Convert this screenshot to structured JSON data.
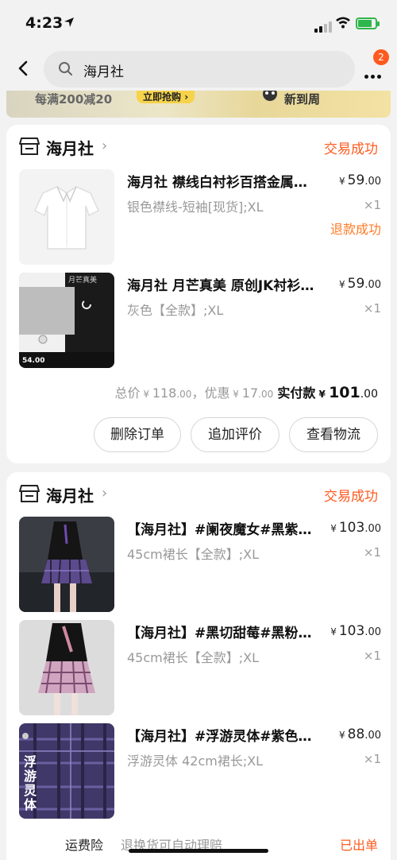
{
  "status_bar": {
    "time": "4:23",
    "location_icon": "location-arrow-icon",
    "battery_color": "#2fb64c"
  },
  "nav": {
    "search_text": "海月社",
    "badge_count": "2"
  },
  "banner": {
    "promo_text": "每满200减20",
    "button_label": "立即抢购",
    "right_text": "新到周"
  },
  "colors": {
    "accent": "#ff5a1f",
    "refund": "#ff7a26"
  },
  "orders": [
    {
      "shop_name": "海月社",
      "status": "交易成功",
      "items": [
        {
          "title": "海月社 襟线白衬衫百搭金属扣短袖衬衫",
          "price_currency": "¥",
          "price_int": "59",
          "price_dec": ".00",
          "variant": "银色襟线-短袖[现货];XL",
          "qty": "×1",
          "refund": "退款成功"
        },
        {
          "title": "海月社 月芒真美 原创JK衬衫长袖",
          "price_currency": "¥",
          "price_int": "59",
          "price_dec": ".00",
          "variant": "灰色【全款】;XL",
          "qty": "×1",
          "thumb_text": "月芒真美",
          "thumb_price": "54.00"
        }
      ],
      "summary": {
        "total_label": "总价",
        "total_int": "118",
        "total_dec": ".00",
        "discount_label": "，优惠",
        "discount_int": "17",
        "discount_dec": ".00",
        "paid_label": "实付款",
        "paid_int": "101",
        "paid_dec": ".00",
        "currency": "¥"
      },
      "buttons": [
        "删除订单",
        "追加评价",
        "查看物流"
      ]
    },
    {
      "shop_name": "海月社",
      "status": "交易成功",
      "items": [
        {
          "title": "【海月社】#阑夜魔女#黑紫格JK裙",
          "price_currency": "¥",
          "price_int": "103",
          "price_dec": ".00",
          "variant": "45cm裙长【全款】;XL",
          "qty": "×1"
        },
        {
          "title": "【海月社】#黑切甜莓#黑粉格JK裙",
          "price_currency": "¥",
          "price_int": "103",
          "price_dec": ".00",
          "variant": "45cm裙长【全款】;XL",
          "qty": "×1"
        },
        {
          "title": "【海月社】#浮游灵体#紫色格JK裙",
          "price_currency": "¥",
          "price_int": "88",
          "price_dec": ".00",
          "variant": "浮游灵体 42cm裙长;XL",
          "qty": "×1",
          "thumb_text": "浮游灵体"
        }
      ],
      "footer": {
        "label": "运费险",
        "desc": "退换货可自动理赔",
        "status": "已出单"
      }
    }
  ]
}
